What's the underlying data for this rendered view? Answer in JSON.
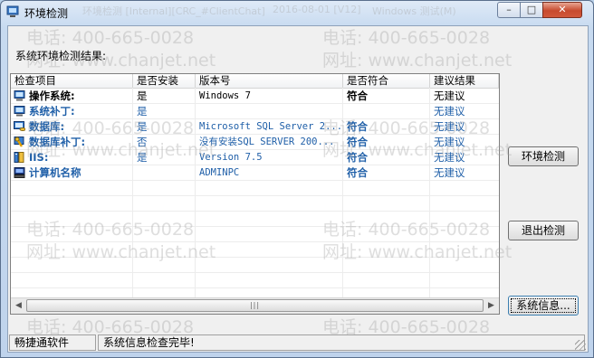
{
  "window": {
    "title": "环境检测",
    "minimize_glyph": "–",
    "maximize_glyph": "□",
    "close_glyph": "✕"
  },
  "result_label": "系统环境检测结果:",
  "table": {
    "headers": [
      "检查项目",
      "是否安装",
      "版本号",
      "是否符合",
      "建议结果"
    ],
    "rows": [
      {
        "icon": "computer-icon",
        "item": "操作系统:",
        "installed": "是",
        "version": "Windows 7",
        "ok": "符合",
        "advice": "无建议"
      },
      {
        "icon": "computer-icon",
        "item": "系统补丁:",
        "installed": "是",
        "version": "",
        "ok": "",
        "advice": "无建议"
      },
      {
        "icon": "database-icon",
        "item": "数据库:",
        "installed": "是",
        "version": "Microsoft SQL Server 2...",
        "ok": "符合",
        "advice": "无建议"
      },
      {
        "icon": "wrench-icon",
        "item": "数据库补丁:",
        "installed": "否",
        "version": "没有安装SQL SERVER 200...",
        "ok": "符合",
        "advice": "无建议"
      },
      {
        "icon": "iis-icon",
        "item": "IIS:",
        "installed": "是",
        "version": "Version 7.5",
        "ok": "符合",
        "advice": "无建议"
      },
      {
        "icon": "server-icon",
        "item": "计算机名称",
        "installed": "",
        "version": "ADMINPC",
        "ok": "符合",
        "advice": "无建议"
      }
    ],
    "scroll_left": "◀",
    "scroll_right": "▶",
    "scroll_grip": "|||"
  },
  "buttons": {
    "check": "环境检测",
    "exit": "退出检测",
    "sysinfo": "系统信息..."
  },
  "status": {
    "left": "畅捷通软件",
    "right": "系统信息检查完毕!"
  },
  "watermark": {
    "phone": "电话: 400-665-0028",
    "site": "网址: www.chanjet.net",
    "title_ghost_1": "环境检测 [Internal][CRC_#ClientChat]",
    "title_ghost_2": "2016-08-01 [V12]",
    "title_ghost_3": "Windows 测试(M)"
  },
  "colors": {
    "link_blue": "#1f5fa8",
    "close_red": "#c74a2e"
  }
}
